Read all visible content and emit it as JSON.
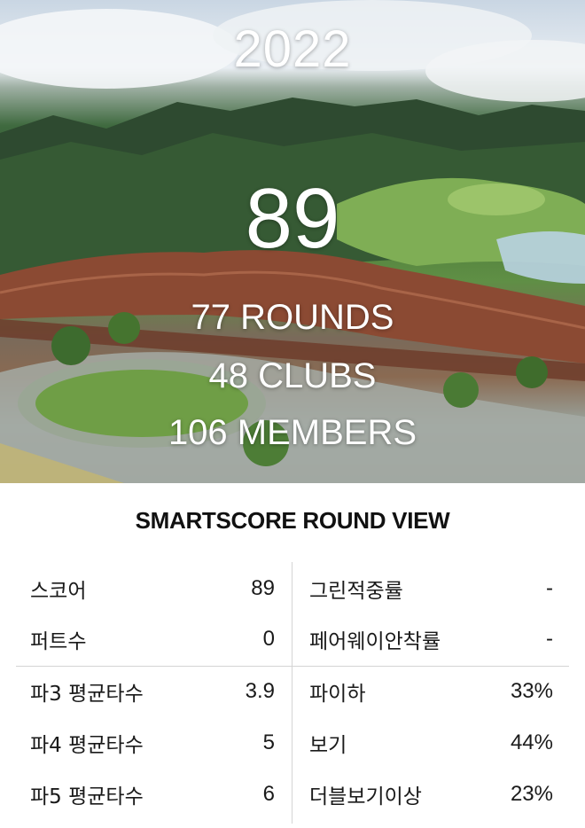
{
  "hero": {
    "year": "2022",
    "score": "89",
    "rounds": "77 ROUNDS",
    "clubs": "48 CLUBS",
    "members": "106 MEMBERS"
  },
  "section_title": "SMARTSCORE ROUND VIEW",
  "stats": {
    "left": [
      {
        "label": "스코어",
        "value": "89"
      },
      {
        "label": "퍼트수",
        "value": "0"
      },
      {
        "label": "파3 평균타수",
        "value": "3.9"
      },
      {
        "label": "파4 평균타수",
        "value": "5"
      },
      {
        "label": "파5 평균타수",
        "value": "6"
      }
    ],
    "right": [
      {
        "label": "그린적중률",
        "value": "-"
      },
      {
        "label": "페어웨이안착률",
        "value": "-"
      },
      {
        "label": "파이하",
        "value": "33%"
      },
      {
        "label": "보기",
        "value": "44%"
      },
      {
        "label": "더블보기이상",
        "value": "23%"
      }
    ]
  }
}
